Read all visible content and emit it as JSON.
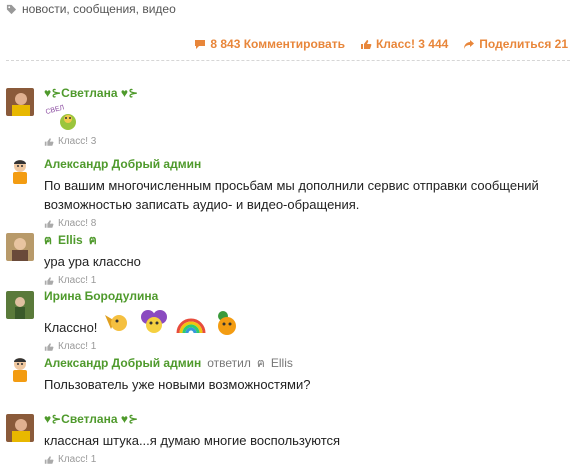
{
  "tags": "новости, сообщения, видео",
  "actions": {
    "comments": "8 843 Комментировать",
    "klass": "Класс! 3 444",
    "share": "Поделиться 21"
  },
  "comments": [
    {
      "author": "♥⊱Светлана ♥⊱",
      "text": "",
      "sticker_text": "СВЕЛ",
      "likes": "Класс! 3"
    },
    {
      "author": "Александр Добрый админ",
      "text": "По вашим многочисленным просьбам мы дополнили сервис отправки сообщений возможностью записать аудио- и видео-обращения.",
      "likes": "Класс! 8"
    },
    {
      "author": "Ellis",
      "text": "ура ура классно",
      "likes": "Класс! 1"
    },
    {
      "author": "Ирина Бородулина",
      "text": "Классно!",
      "likes": "Класс! 1"
    },
    {
      "author": "Александр Добрый админ",
      "replied": "ответил",
      "reply_to": "Ellis",
      "text": "Пользователь уже новыми возможностями?",
      "likes": "Класс! 1"
    },
    {
      "author": "♥⊱Светлана ♥⊱",
      "text": "классная штука...я думаю многие воспользуются",
      "likes": "Класс! 1"
    }
  ],
  "colors": {
    "accent": "#e8863a",
    "author": "#4f9a2c"
  }
}
